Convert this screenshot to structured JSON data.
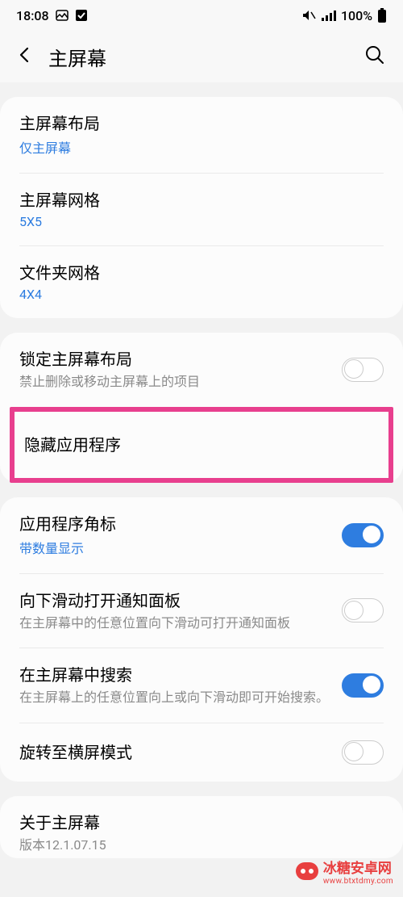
{
  "status": {
    "time": "18:08",
    "battery": "100%"
  },
  "header": {
    "title": "主屏幕"
  },
  "section1": {
    "layout": {
      "title": "主屏幕布局",
      "sub": "仅主屏幕"
    },
    "grid": {
      "title": "主屏幕网格",
      "sub": "5X5"
    },
    "folder": {
      "title": "文件夹网格",
      "sub": "4X4"
    }
  },
  "section2": {
    "lock": {
      "title": "锁定主屏幕布局",
      "desc": "禁止删除或移动主屏幕上的项目",
      "on": false
    },
    "hide": {
      "title": "隐藏应用程序"
    }
  },
  "section3": {
    "badge": {
      "title": "应用程序角标",
      "sub": "带数量显示",
      "on": true
    },
    "swipe": {
      "title": "向下滑动打开通知面板",
      "desc": "在主屏幕中的任意位置向下滑动可打开通知面板",
      "on": false
    },
    "search": {
      "title": "在主屏幕中搜索",
      "desc": "在主屏幕上的任意位置向上或向下滑动即可开始搜索。",
      "on": true
    },
    "rotate": {
      "title": "旋转至横屏模式",
      "on": false
    }
  },
  "section4": {
    "about": {
      "title": "关于主屏幕",
      "desc": "版本12.1.07.15"
    }
  },
  "watermark": {
    "text": "冰糖安卓网",
    "url": "www.btxtdmy.com"
  }
}
